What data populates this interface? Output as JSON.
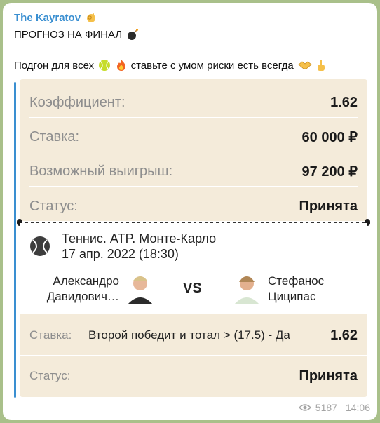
{
  "post": {
    "channel": "The Kayratov",
    "channel_emoji": "ok-hand-icon",
    "headline": "ПРОГНОЗ НА ФИНАЛ",
    "headline_emoji": "bomb-icon",
    "subline": "Подгон для всех",
    "subline_tail": "ставьте с умом риски есть всегда",
    "views": "5187",
    "time": "14:06"
  },
  "ticket": {
    "rows": [
      {
        "label": "Коэффициент:",
        "value": "1.62"
      },
      {
        "label": "Ставка:",
        "value": "60 000 ₽"
      },
      {
        "label": "Возможный выигрыш:",
        "value": "97 200 ₽"
      },
      {
        "label": "Статус:",
        "value": "Принята"
      }
    ],
    "match": {
      "title": "Теннис. ATP. Монте-Карло",
      "date": "17 апр. 2022 (18:30)",
      "player1_line1": "Александро",
      "player1_line2": "Давидович…",
      "vs": "VS",
      "player2_line1": "Стефанос",
      "player2_line2": "Циципас"
    },
    "bet": {
      "label": "Ставка:",
      "description": "Второй победит и тотал > (17.5) - Да",
      "odds": "1.62"
    },
    "status": {
      "label": "Статус:",
      "value": "Принята"
    }
  },
  "colors": {
    "accent": "#3a8fd1",
    "ticket_bg": "#f4ebda",
    "chat_bg": "#a9c08a"
  }
}
